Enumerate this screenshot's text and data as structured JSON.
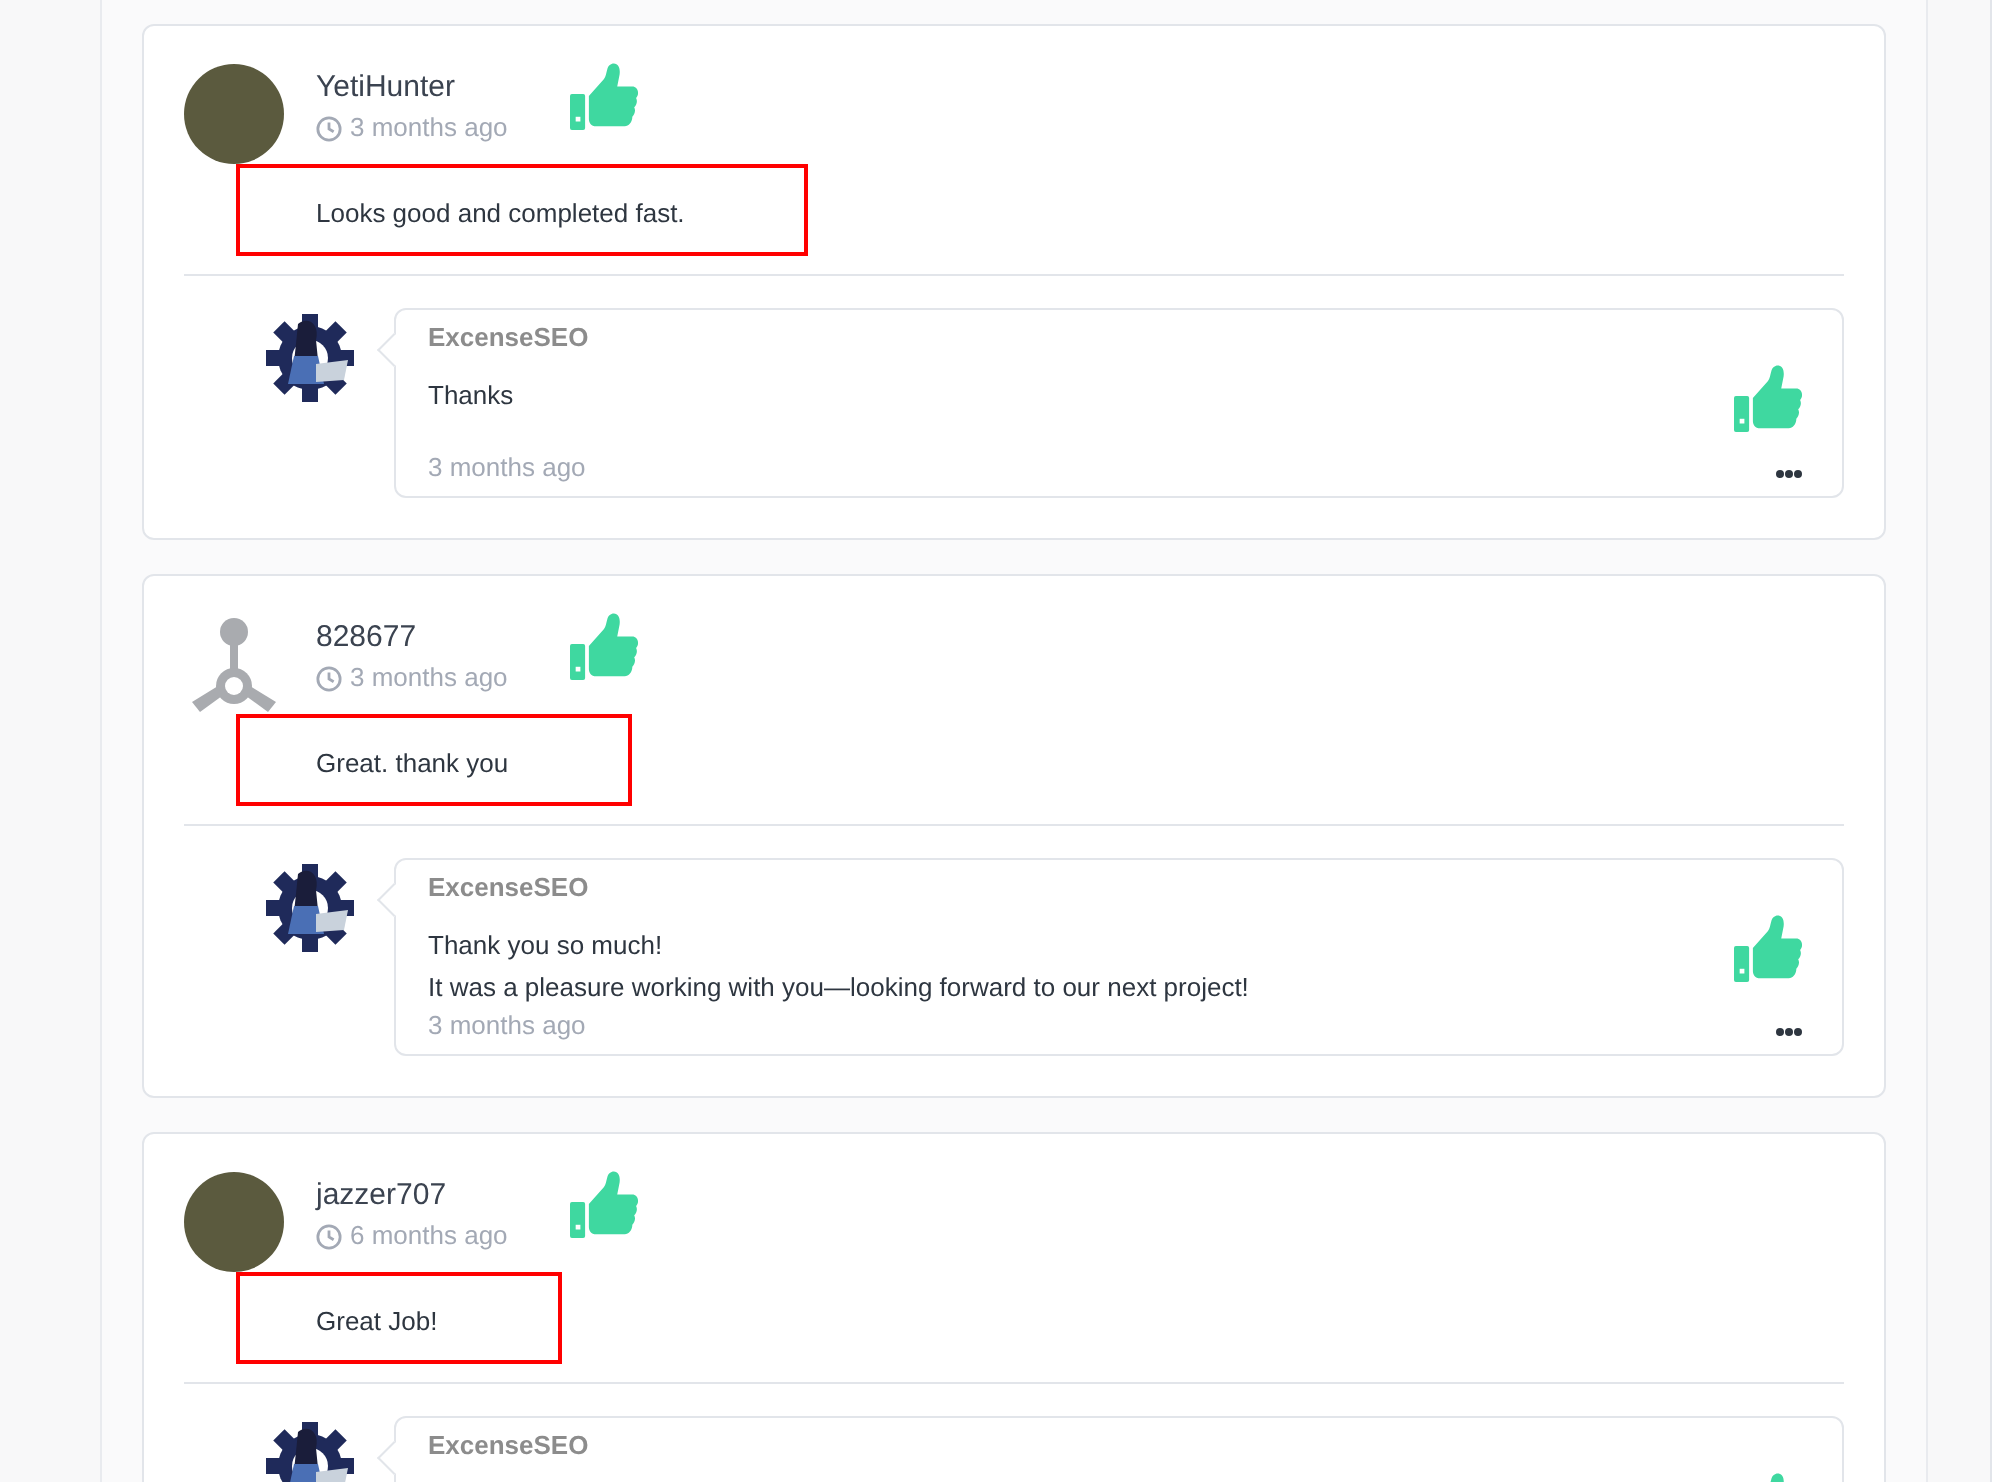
{
  "reviews": [
    {
      "author": "YetiHunter",
      "avatar": {
        "kind": "photo"
      },
      "time": "3 months ago",
      "liked": true,
      "text": "Looks good and completed fast.",
      "highlighted": true,
      "reply": {
        "author": "ExcenseSEO",
        "lines": [
          "Thanks"
        ],
        "time": "3 months ago",
        "liked": true
      }
    },
    {
      "author": "828677",
      "avatar": {
        "kind": "default"
      },
      "time": "3 months ago",
      "liked": true,
      "text": "Great. thank you",
      "highlighted": true,
      "reply": {
        "author": "ExcenseSEO",
        "lines": [
          "Thank you so much!",
          "It was a pleasure working with you—looking forward to our next project!"
        ],
        "time": "3 months ago",
        "liked": true
      }
    },
    {
      "author": "jazzer707",
      "avatar": {
        "kind": "photo"
      },
      "time": "6 months ago",
      "liked": true,
      "text": "Great Job!",
      "highlighted": true,
      "reply": {
        "author": "ExcenseSEO",
        "liked": true
      }
    }
  ]
}
